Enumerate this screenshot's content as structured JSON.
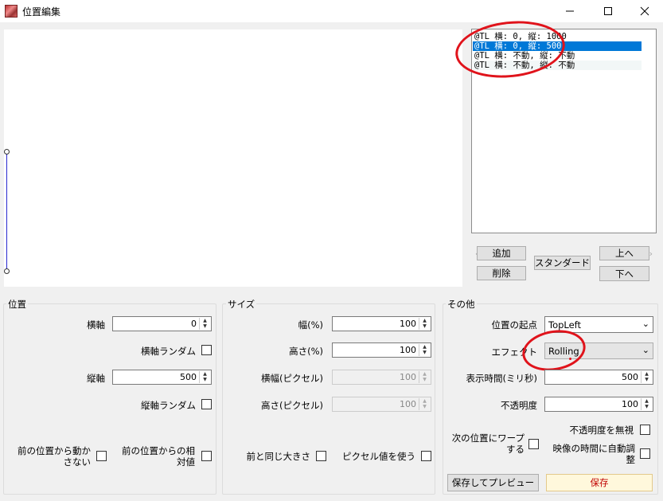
{
  "window": {
    "title": "位置編集",
    "minimize_icon": "minimize-icon",
    "maximize_icon": "maximize-icon",
    "close_icon": "close-icon"
  },
  "list": {
    "items": [
      {
        "label": "@TL 横: 0, 縦: 1000",
        "selected": false
      },
      {
        "label": "@TL 横: 0, 縦: 500",
        "selected": true
      },
      {
        "label": "@TL 横: 不動, 縦: 不動",
        "selected": false
      },
      {
        "label": "@TL 横: 不動, 縦: 不動",
        "selected": false
      }
    ]
  },
  "list_buttons": {
    "add": "追加",
    "delete": "削除",
    "standard": "スタンダード",
    "up": "上へ",
    "down": "下へ"
  },
  "position": {
    "title": "位置",
    "x_label": "横軸",
    "x_value": "0",
    "x_random_label": "横軸ランダム",
    "y_label": "縦軸",
    "y_value": "500",
    "y_random_label": "縦軸ランダム",
    "no_move_label": "前の位置から動かさない",
    "relative_label": "前の位置からの相対値"
  },
  "size": {
    "title": "サイズ",
    "width_pct_label": "幅(%)",
    "width_pct_value": "100",
    "height_pct_label": "高さ(%)",
    "height_pct_value": "100",
    "width_px_label": "横幅(ピクセル)",
    "width_px_value": "100",
    "height_px_label": "高さ(ピクセル)",
    "height_px_value": "100",
    "same_size_label": "前と同じ大きさ",
    "use_pixel_label": "ピクセル値を使う"
  },
  "other": {
    "title": "その他",
    "origin_label": "位置の起点",
    "origin_value": "TopLeft",
    "effect_label": "エフェクト",
    "effect_value": "Rolling",
    "duration_label": "表示時間(ミリ秒)",
    "duration_value": "500",
    "opacity_label": "不透明度",
    "opacity_value": "100",
    "ignore_opacity_label": "不透明度を無視",
    "warp_label": "次の位置にワープする",
    "auto_adjust_label": "映像の時間に自動調整",
    "save_preview_label": "保存してプレビュー",
    "save_label": "保存"
  },
  "colors": {
    "selection": "#0078d7",
    "annotation": "#e0131b",
    "save_bg": "#fff8dc",
    "save_text": "#c00000",
    "path_line": "#2a2ad0"
  }
}
